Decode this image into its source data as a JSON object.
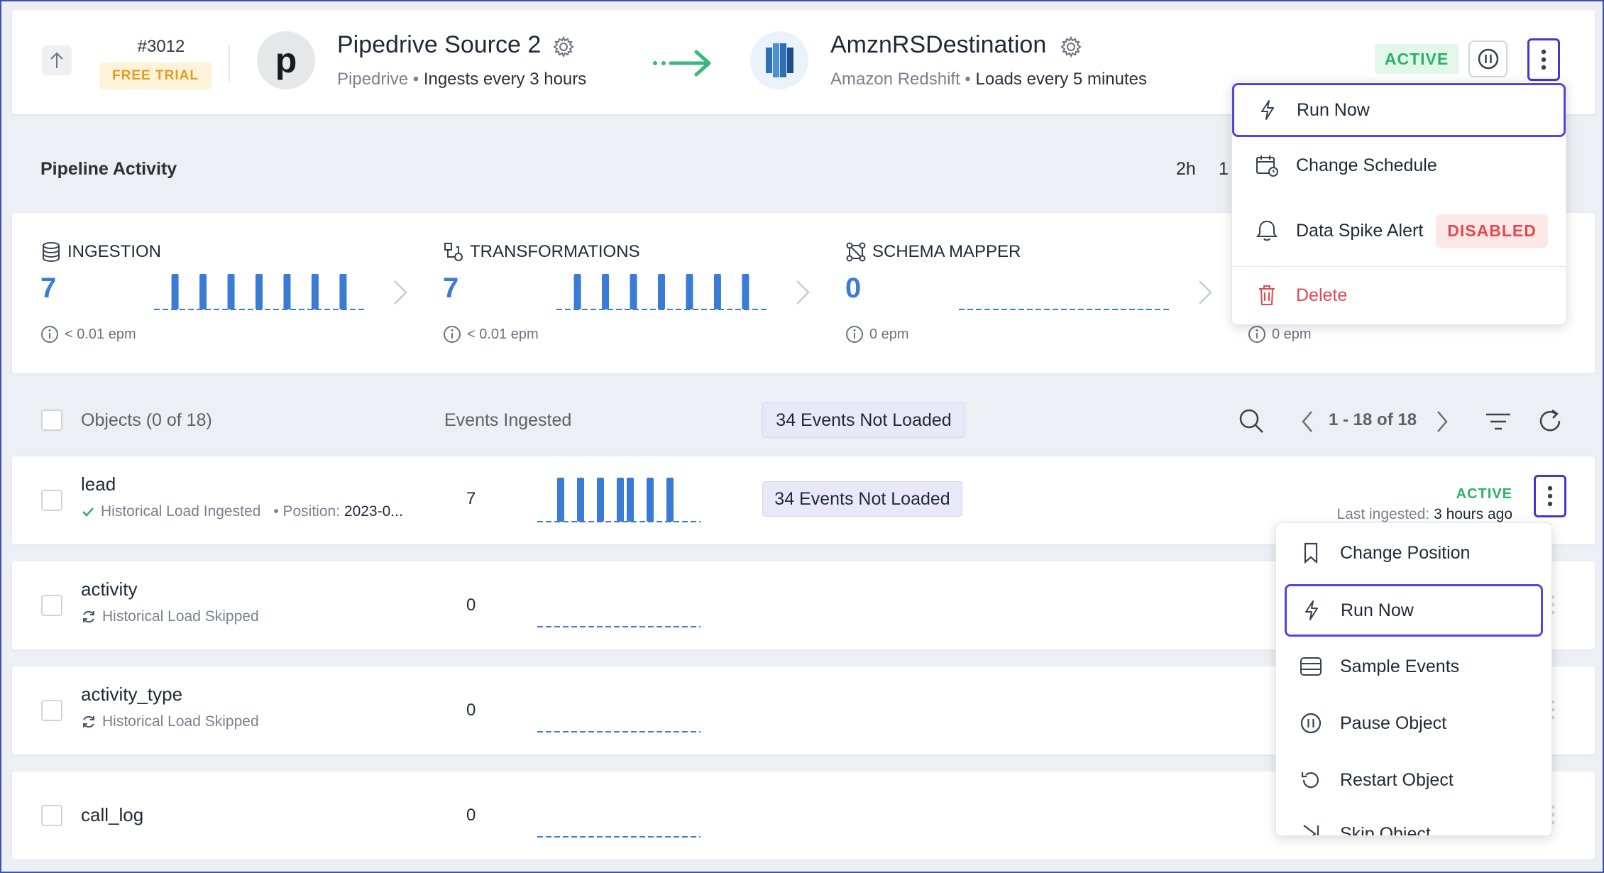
{
  "pipeline": {
    "id": "#3012",
    "trial_label": "FREE TRIAL",
    "status": "ACTIVE",
    "source": {
      "logo_letter": "p",
      "name": "Pipedrive Source 2",
      "type": "Pipedrive",
      "schedule": "Ingests every 3 hours"
    },
    "destination": {
      "name": "AmznRSDestination",
      "type": "Amazon Redshift",
      "schedule": "Loads every 5 minutes"
    }
  },
  "activity": {
    "title": "Pipeline Activity",
    "range_options": [
      "2h",
      "1"
    ],
    "stages": [
      {
        "label": "INGESTION",
        "count": "7",
        "epm": "< 0.01 epm",
        "icon": "database-icon",
        "spark": [
          0,
          1,
          0,
          1,
          0,
          1,
          0,
          1,
          0,
          1,
          0,
          1,
          0,
          1,
          0
        ]
      },
      {
        "label": "TRANSFORMATIONS",
        "count": "7",
        "epm": "< 0.01 epm",
        "icon": "transform-icon",
        "spark": [
          0,
          1,
          0,
          1,
          0,
          1,
          0,
          1,
          0,
          1,
          0,
          1,
          0,
          1,
          0
        ]
      },
      {
        "label": "SCHEMA MAPPER",
        "count": "0",
        "epm": "0 epm",
        "icon": "schema-icon",
        "spark": [
          0,
          0,
          0,
          0,
          0,
          0,
          0,
          0,
          0,
          0,
          0,
          0,
          0,
          0,
          0
        ]
      },
      {
        "label": "",
        "count": "",
        "epm": "0 epm",
        "icon": "",
        "spark": []
      }
    ]
  },
  "objects": {
    "header_label": "Objects (0 of 18)",
    "events_header": "Events Ingested",
    "not_loaded_header": "34 Events Not Loaded",
    "pagination": "1 - 18 of 18",
    "rows": [
      {
        "name": "lead",
        "status_text": "Historical Load Ingested",
        "position_label": "Position:",
        "position_value": "2023-0...",
        "count": "7",
        "not_loaded": "34 Events Not Loaded",
        "status": "ACTIVE",
        "last_label": "Last ingested:",
        "last_value": "3 hours ago"
      },
      {
        "name": "activity",
        "status_text": "Historical Load Skipped",
        "count": "0"
      },
      {
        "name": "activity_type",
        "status_text": "Historical Load Skipped",
        "count": "0"
      },
      {
        "name": "call_log",
        "count": "0"
      }
    ]
  },
  "pipeline_menu": {
    "items": [
      {
        "label": "Run Now",
        "icon": "lightning-icon"
      },
      {
        "label": "Change Schedule",
        "icon": "calendar-icon"
      },
      {
        "label": "Data Spike Alert",
        "icon": "alert-icon",
        "badge": "DISABLED"
      },
      {
        "label": "Delete",
        "icon": "trash-icon",
        "color": "#e5484d"
      }
    ]
  },
  "object_menu": {
    "items": [
      {
        "label": "Change Position",
        "icon": "bookmark-icon"
      },
      {
        "label": "Run Now",
        "icon": "lightning-icon"
      },
      {
        "label": "Sample Events",
        "icon": "list-icon"
      },
      {
        "label": "Pause Object",
        "icon": "pause-icon"
      },
      {
        "label": "Restart Object",
        "icon": "restart-icon"
      },
      {
        "label": "Skip Object",
        "icon": "skip-icon"
      }
    ]
  },
  "colors": {
    "accent": "#4338ca",
    "active_green": "#27b368",
    "chart_blue": "#3a7bd5",
    "danger": "#e5484d"
  }
}
